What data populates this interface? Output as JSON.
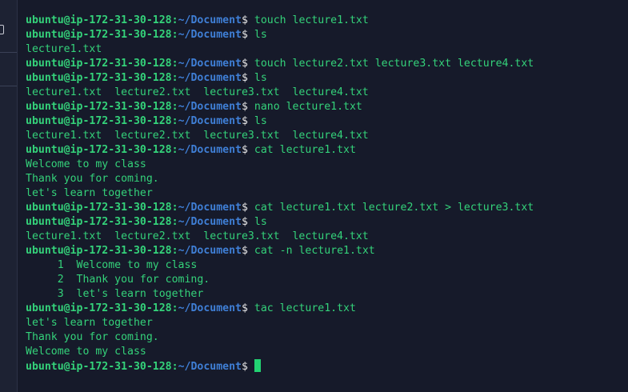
{
  "prompt": {
    "user_host": "ubuntu@ip-172-31-30-128",
    "colon": ":",
    "path": "~/Document",
    "symbol": "$"
  },
  "lines": [
    {
      "type": "prompt",
      "command": "touch lecture1.txt"
    },
    {
      "type": "prompt",
      "command": "ls"
    },
    {
      "type": "output",
      "text": "lecture1.txt"
    },
    {
      "type": "prompt",
      "command": "touch lecture2.txt lecture3.txt lecture4.txt"
    },
    {
      "type": "prompt",
      "command": "ls"
    },
    {
      "type": "output",
      "text": "lecture1.txt  lecture2.txt  lecture3.txt  lecture4.txt"
    },
    {
      "type": "prompt",
      "command": "nano lecture1.txt"
    },
    {
      "type": "prompt",
      "command": "ls"
    },
    {
      "type": "output",
      "text": "lecture1.txt  lecture2.txt  lecture3.txt  lecture4.txt"
    },
    {
      "type": "prompt",
      "command": "cat lecture1.txt"
    },
    {
      "type": "output",
      "text": "Welcome to my class"
    },
    {
      "type": "output",
      "text": "Thank you for coming."
    },
    {
      "type": "output",
      "text": "let's learn together"
    },
    {
      "type": "prompt",
      "command": "cat lecture1.txt lecture2.txt > lecture3.txt"
    },
    {
      "type": "prompt",
      "command": "ls"
    },
    {
      "type": "output",
      "text": "lecture1.txt  lecture2.txt  lecture3.txt  lecture4.txt"
    },
    {
      "type": "prompt",
      "command": "cat -n lecture1.txt"
    },
    {
      "type": "output",
      "text": "     1  Welcome to my class"
    },
    {
      "type": "output",
      "text": "     2  Thank you for coming."
    },
    {
      "type": "output",
      "text": "     3  let's learn together"
    },
    {
      "type": "prompt",
      "command": "tac lecture1.txt"
    },
    {
      "type": "output",
      "text": "let's learn together"
    },
    {
      "type": "output",
      "text": "Thank you for coming."
    },
    {
      "type": "output",
      "text": "Welcome to my class"
    },
    {
      "type": "prompt",
      "command": "",
      "cursor": true
    }
  ],
  "colors": {
    "background": "#161a2a",
    "prompt_green": "#34d27a",
    "path_blue": "#3f7fd6",
    "cursor": "#22d372"
  }
}
